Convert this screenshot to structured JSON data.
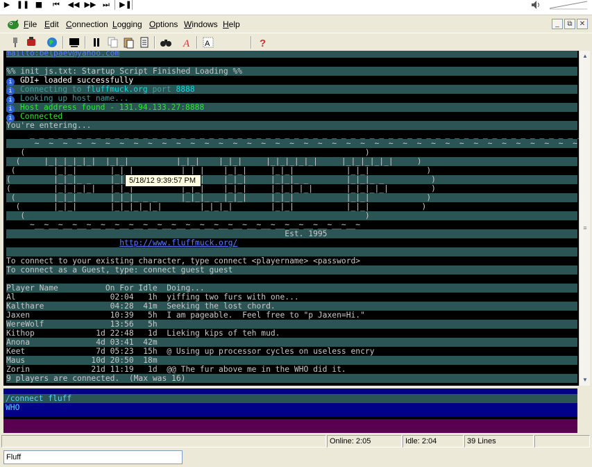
{
  "media": {
    "buttons": [
      "▶",
      "❚❚",
      "■",
      "⏮",
      "◀◀",
      "▶▶",
      "⏭",
      "▶❚"
    ],
    "volume_icon": "speaker-icon"
  },
  "menu": [
    "File",
    "Edit",
    "Connection",
    "Logging",
    "Options",
    "Windows",
    "Help"
  ],
  "window_controls": [
    "_",
    "⧉",
    "✕"
  ],
  "toolbar_icons": [
    "connect-plug-icon",
    "disconnect-icon",
    "world-globe-icon",
    "console-icon",
    "pause-icon",
    "copy-icon",
    "paste-icon",
    "log-icon",
    "find-binoculars-icon",
    "font-icon",
    "highlight-icon",
    "substitute-icon",
    "macro-icon",
    "help-icon"
  ],
  "terminal": {
    "lines": [
      {
        "text": "mailto:belpaev@yahoo.com",
        "style": "link",
        "striped": true
      },
      {
        "text": "",
        "striped": false
      },
      {
        "text": "%% init_js.txt: Startup Script Finished Loading %%",
        "striped": true
      },
      {
        "text": "GDI+ loaded successfully",
        "bullet": true,
        "style": "white",
        "striped": false
      },
      {
        "text": "Connecting to fluffmuck.org port 8888",
        "bullet": true,
        "style": "dim",
        "striped": true
      },
      {
        "text": "Looking up host name...",
        "bullet": true,
        "style": "dim",
        "striped": false
      },
      {
        "text": "Host address found - 131.94.133.27:8888",
        "bullet": true,
        "style": "green",
        "striped": true
      },
      {
        "text": "Connected",
        "bullet": true,
        "style": "green",
        "striped": false
      },
      {
        "text": "You're entering...",
        "striped": true
      },
      {
        "text": "     _ _ _ _ _ _ _ _ _ _ _ _ _ _ _ _ _ _ _ _ _ _ _ _ _ _ _ _ _ _ _ _ _ _ _ _ _ _ _ _ _ _ _ _ _ _ _ _ _ _ _ _ _ _ _ _ _ _ _ _ _ _ _ _ _ _ _ _ _ _ _",
        "striped": false
      },
      {
        "text": "      ~  ~  ~  ~  ~  ~  ~  ~  ~  ~  ~  ~  ~  ~  ~  ~  ~  ~  ~  ~  ~  ~  ~  ~  ~  ~  ~  ~  ~  ~  ~  ~  ~  ~  ~  ~  ~  ~  ~  ~  ~  ~  ~  ~  ~  ~  ~  ~  ~  ~  ~  ~  ~  ~  ~  ~  ~  ~  ~  ~  ~  ~  ~  ~  ~  ~  ~  ~",
        "striped": true
      },
      {
        "text": "   (                                                                        )",
        "striped": false
      },
      {
        "text": "  (     |_|_|_|_|_|  |_|_|          |_|_|    |_|_|     |_|_|_|_|_|     |_|_|_|_|_|     )",
        "striped": true
      },
      {
        "text": " (        |_|_|       |_|_|          |_|_|    |_|_|     |_|_|           |_|_|            )",
        "striped": false
      },
      {
        "text": "(         |_|_|_ _    |_|_|          |_|_|    |_|_|     |_|_|_ _        |_|_|_ _          )",
        "striped": true
      },
      {
        "text": "(         |_|_|_|_|   |_|_|          |_|_|    |_|_|     |_|_|_|_|       |_|_|_|_|         )",
        "striped": false
      },
      {
        "text": " (        |_|_|       |_|_|_ _ _     |_|_|_ _ |_|_|     |_|_|           |_|_|            )",
        "striped": true
      },
      {
        "text": "  (       |_|_|       |_|_|_|_|_|        |_|_|_|        |_|_|           |_|_|           )",
        "striped": false
      },
      {
        "text": "   (                                                                        )",
        "striped": true
      },
      {
        "text": "     ~__~__~__~__~__~__~__~__~__~__~__~__~__~__~__~__~__~__~__~__~__~__~__~",
        "striped": false
      },
      {
        "text": "                                                           Est. 1995",
        "striped": true
      },
      {
        "text": "                        http://www.fluffmuck.org/",
        "style": "link-inline",
        "striped": false
      },
      {
        "text": "",
        "striped": true
      },
      {
        "text": "To connect to your existing character, type connect <playername> <password>",
        "striped": false
      },
      {
        "text": "To connect as a Guest, type: connect guest guest",
        "striped": true
      },
      {
        "text": "",
        "striped": false
      },
      {
        "text": "Player Name          On For Idle  Doing...",
        "striped": true
      },
      {
        "text": "Al                    02:04   1h  yiffing two furs with one...",
        "striped": false
      },
      {
        "text": "Kalthare              04:28  41m  Seeking the lost chord.",
        "striped": true
      },
      {
        "text": "Jaxen                 10:39   5h  I am pageable.  Feel free to \"p Jaxen=Hi.\"",
        "striped": false
      },
      {
        "text": "WereWolf              13:56   5h",
        "striped": true
      },
      {
        "text": "Kithop             1d 22:48   1d  Lieking kips of teh mud.",
        "striped": false
      },
      {
        "text": "Anona              4d 03:41  42m",
        "striped": true
      },
      {
        "text": "Keet               7d 05:23  15h  @ Using up processor cycles on useless encry",
        "striped": false
      },
      {
        "text": "Maus              10d 20:50  18m",
        "striped": true
      },
      {
        "text": "Zorin             21d 11:19   1d  @@ The fur above me in the WHO did it.",
        "striped": false
      },
      {
        "text": "9 players are connected.  (Max was 16)",
        "striped": true
      }
    ],
    "tooltip": "5/18/12  9:39:57 PM"
  },
  "input": {
    "lines": [
      "/connect fluff",
      "WHO"
    ]
  },
  "status": {
    "online": "Online: 2:05",
    "idle": "Idle: 2:04",
    "lines": "39 Lines"
  },
  "bottom_field": "Fluff",
  "colors": {
    "stripe": "#2b5454",
    "input_bg": "#000088",
    "strip_bg": "#5a0050"
  }
}
